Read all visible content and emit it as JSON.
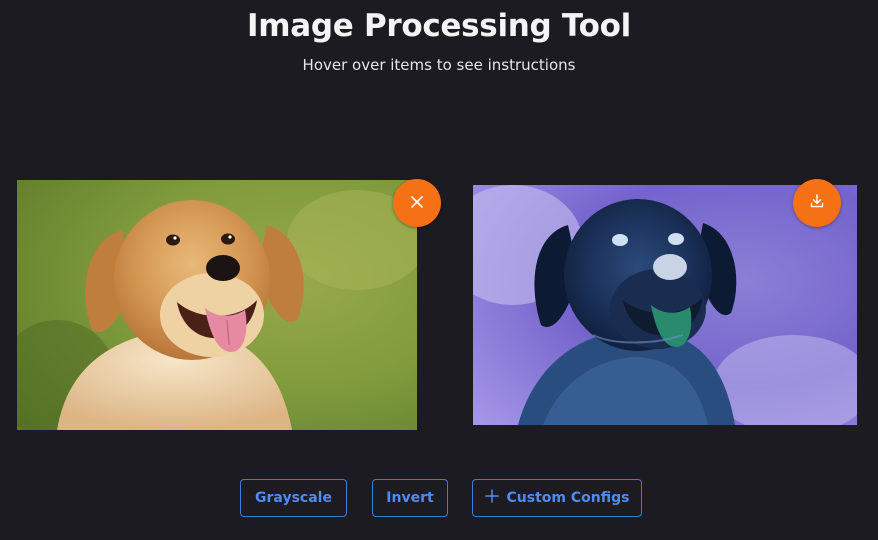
{
  "header": {
    "title": "Image Processing Tool",
    "subtitle": "Hover over items to see instructions"
  },
  "images": {
    "original": {
      "subject": "golden retriever photo"
    },
    "processed": {
      "subject": "color-inverted golden retriever photo"
    }
  },
  "icons": {
    "remove": "close-icon",
    "download": "download-icon",
    "custom_configs": "plus-icon"
  },
  "actions": {
    "grayscale_label": "Grayscale",
    "invert_label": "Invert",
    "custom_configs_label": "Custom Configs"
  },
  "colors": {
    "background": "#1c1b22",
    "accent_orange": "#f67015",
    "button_blue": "#4f8cf0"
  }
}
